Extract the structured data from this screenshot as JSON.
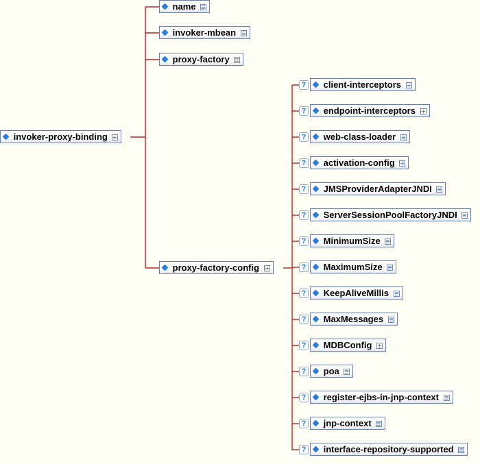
{
  "root": {
    "label": "invoker-proxy-binding",
    "badge": "expand"
  },
  "level1": {
    "name": {
      "label": "name",
      "badge": "text"
    },
    "invoker_mbean": {
      "label": "invoker-mbean",
      "badge": "text"
    },
    "proxy_factory": {
      "label": "proxy-factory",
      "badge": "text"
    },
    "proxy_factory_cfg": {
      "label": "proxy-factory-config",
      "badge": "expand"
    }
  },
  "level2": [
    {
      "key": "client_interceptors",
      "label": "client-interceptors",
      "badge": "expand"
    },
    {
      "key": "endpoint_interceptors",
      "label": "endpoint-interceptors",
      "badge": "expand"
    },
    {
      "key": "web_class_loader",
      "label": "web-class-loader",
      "badge": "text"
    },
    {
      "key": "activation_config",
      "label": "activation-config",
      "badge": "expand"
    },
    {
      "key": "jms_provider_adapter_jndi",
      "label": "JMSProviderAdapterJNDI",
      "badge": "text"
    },
    {
      "key": "server_session_pool_factory_jndi",
      "label": "ServerSessionPoolFactoryJNDI",
      "badge": "text"
    },
    {
      "key": "minimum_size",
      "label": "MinimumSize",
      "badge": "text"
    },
    {
      "key": "maximum_size",
      "label": "MaximumSize",
      "badge": "text"
    },
    {
      "key": "keep_alive_millis",
      "label": "KeepAliveMillis",
      "badge": "text"
    },
    {
      "key": "max_messages",
      "label": "MaxMessages",
      "badge": "text"
    },
    {
      "key": "mdb_config",
      "label": "MDBConfig",
      "badge": "expand"
    },
    {
      "key": "poa",
      "label": "poa",
      "badge": "text"
    },
    {
      "key": "register_ejbs_in_jnp_context",
      "label": "register-ejbs-in-jnp-context",
      "badge": "text"
    },
    {
      "key": "jnp_context",
      "label": "jnp-context",
      "badge": "text"
    },
    {
      "key": "interface_repository_supported",
      "label": "interface-repository-supported",
      "badge": "text"
    }
  ]
}
